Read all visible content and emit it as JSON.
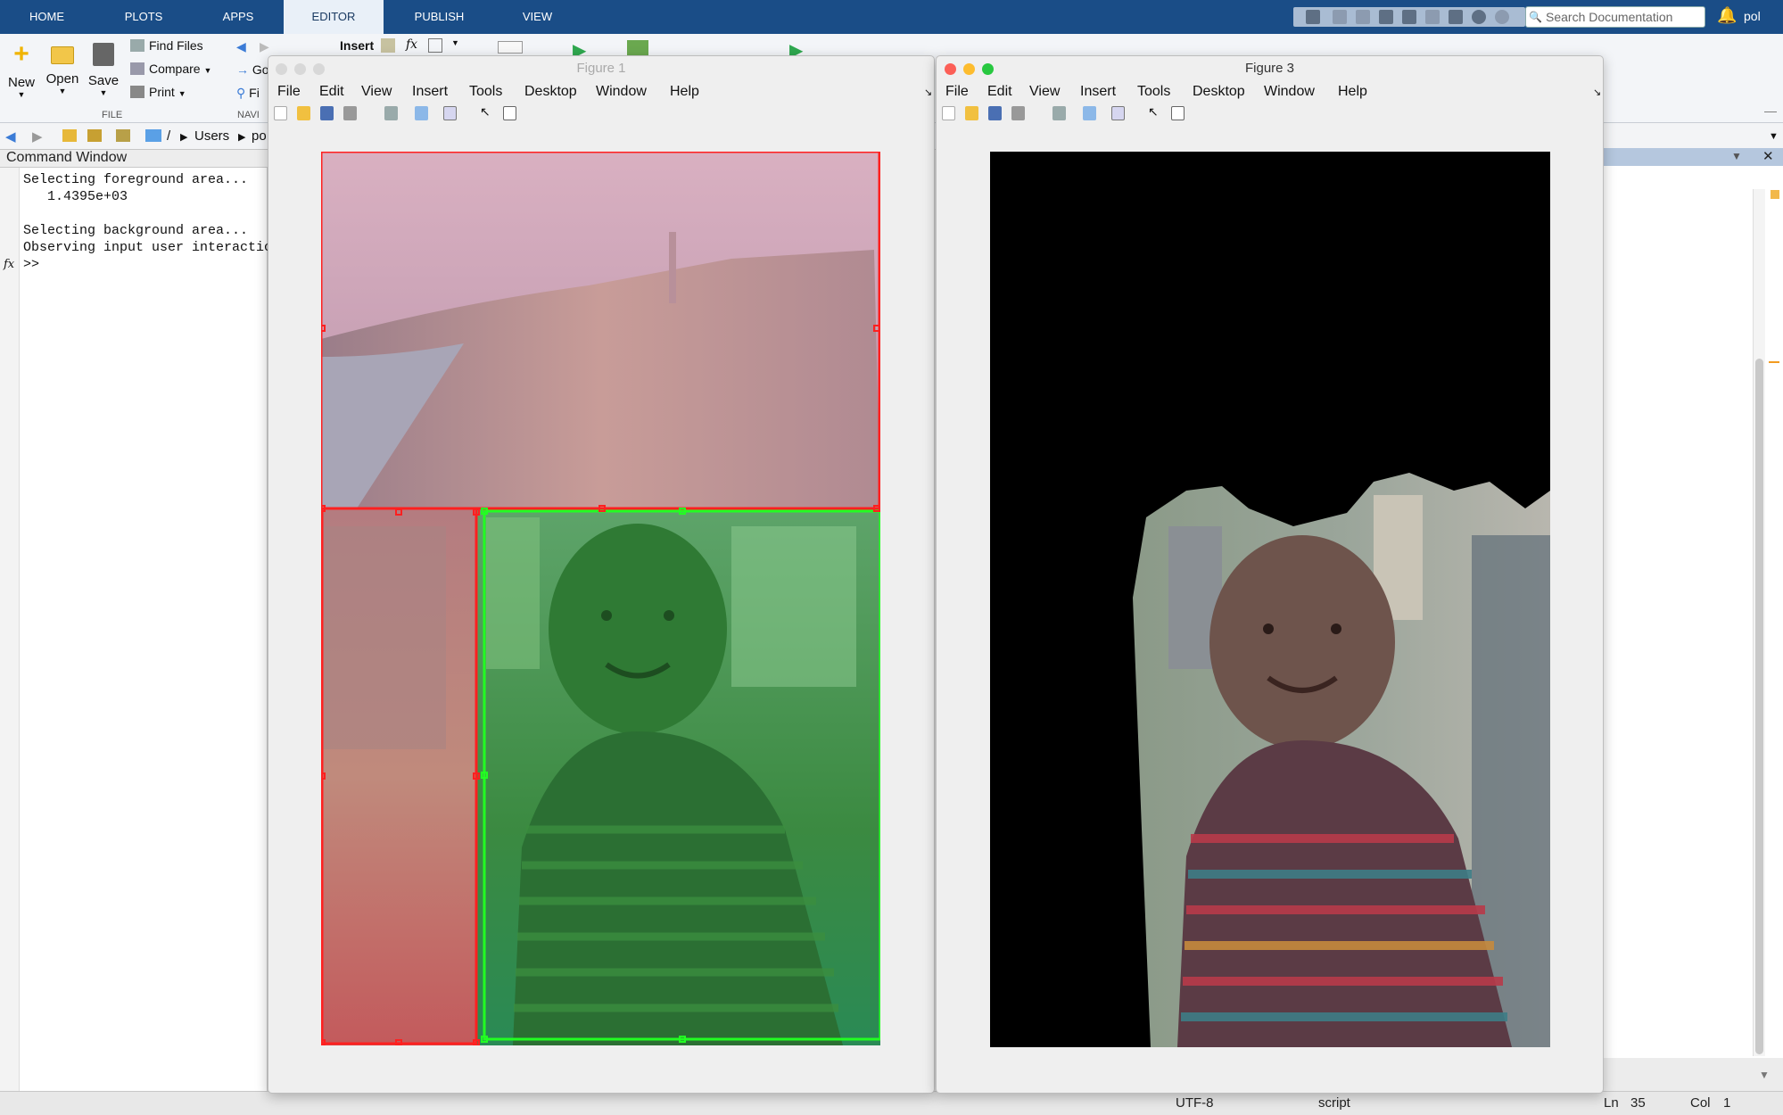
{
  "ribbon_tabs": [
    "HOME",
    "PLOTS",
    "APPS",
    "EDITOR",
    "PUBLISH",
    "VIEW"
  ],
  "search_placeholder": "Search Documentation",
  "user": "pol",
  "ribbon": {
    "new": "New",
    "open": "Open",
    "save": "Save",
    "find_files": "Find Files",
    "compare": "Compare",
    "print": "Print",
    "file_group": "FILE",
    "navigate_group": "NAVI",
    "insert": "Insert",
    "go": "Go",
    "find": "Fi"
  },
  "path": {
    "root": "/",
    "users": "Users",
    "current": "po"
  },
  "command_window": {
    "title": "Command Window",
    "lines": "Selecting foreground area...\n   1.4395e+03\n\nSelecting background area...\nObserving input user interactic\n>>"
  },
  "figure1": {
    "title": "Figure 1",
    "menu": [
      "File",
      "Edit",
      "View",
      "Insert",
      "Tools",
      "Desktop",
      "Window",
      "Help"
    ]
  },
  "figure3": {
    "title": "Figure 3",
    "menu": [
      "File",
      "Edit",
      "View",
      "Insert",
      "Tools",
      "Desktop",
      "Window",
      "Help"
    ]
  },
  "status": {
    "encoding": "UTF-8",
    "type": "script",
    "ln_label": "Ln",
    "ln": "35",
    "col_label": "Col",
    "col": "1"
  },
  "colors": {
    "ribbon_bar": "#1a4d87",
    "roi_background": "#ff0000",
    "roi_foreground": "#00ff00"
  }
}
